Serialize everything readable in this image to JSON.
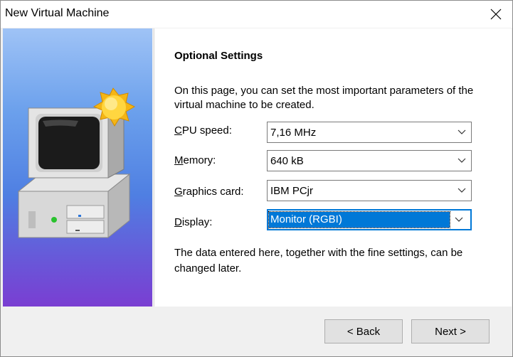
{
  "window": {
    "title": "New Virtual Machine"
  },
  "page": {
    "heading": "Optional Settings",
    "intro": "On this page, you can set the most important parameters of the virtual machine to be created.",
    "outro": "The data entered here, together with the fine settings, can be changed later."
  },
  "fields": [
    {
      "mnemonic": "C",
      "label_rest": "PU speed:",
      "value": "7,16 MHz"
    },
    {
      "mnemonic": "M",
      "label_rest": "emory:",
      "value": "640 kB"
    },
    {
      "mnemonic": "G",
      "label_rest": "raphics card:",
      "value": "IBM PCjr"
    },
    {
      "mnemonic": "D",
      "label_rest": "isplay:",
      "value": "Monitor (RGBI)"
    }
  ],
  "buttons": {
    "back": "< Back",
    "next": "Next >"
  },
  "icons": {
    "close": "close-icon",
    "banner": "computer-icon",
    "sun": "sun-icon",
    "dropdown": "chevron-down-icon"
  },
  "colors": {
    "accent": "#0078d7"
  }
}
